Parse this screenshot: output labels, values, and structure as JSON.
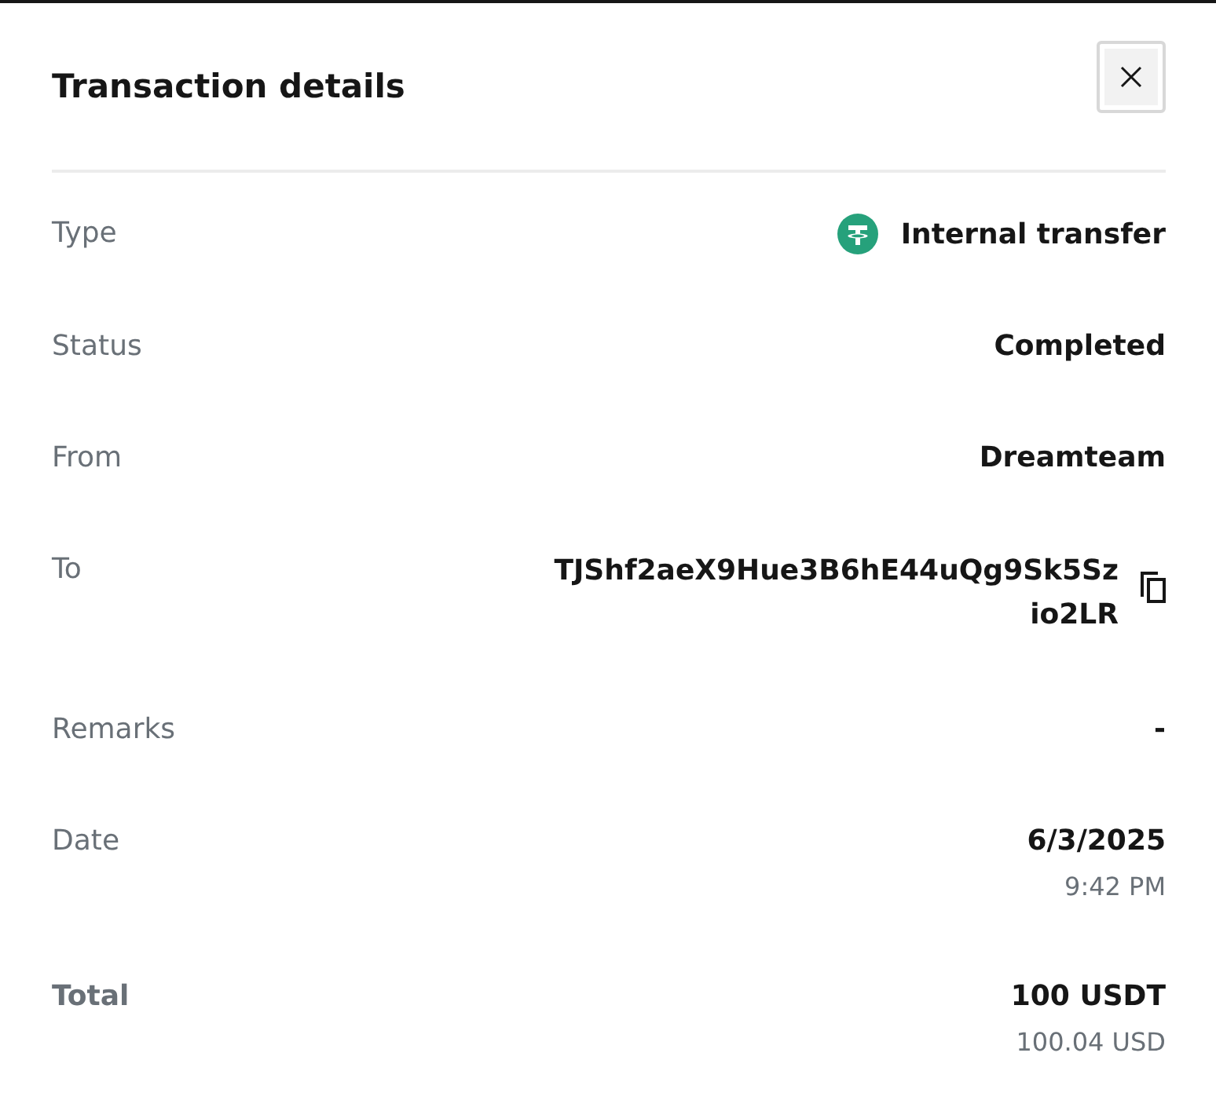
{
  "dialog": {
    "title": "Transaction details"
  },
  "rows": [
    {
      "kind": "icon_value",
      "label": "Type",
      "value": "Internal transfer"
    },
    {
      "kind": "plain",
      "label": "Status",
      "value": "Completed"
    },
    {
      "kind": "plain",
      "label": "From",
      "value": "Dreamteam"
    },
    {
      "kind": "copy",
      "label": "To",
      "value": "TJShf2aeX9Hue3B6hE44uQg9Sk5Szio2LR"
    },
    {
      "kind": "plain",
      "label": "Remarks",
      "value": "-"
    },
    {
      "kind": "sub",
      "label": "Date",
      "value": "6/3/2025",
      "sub": "9:42 PM"
    },
    {
      "kind": "total",
      "label": "Total",
      "value": "100 USDT",
      "sub": "100.04 USD"
    }
  ]
}
